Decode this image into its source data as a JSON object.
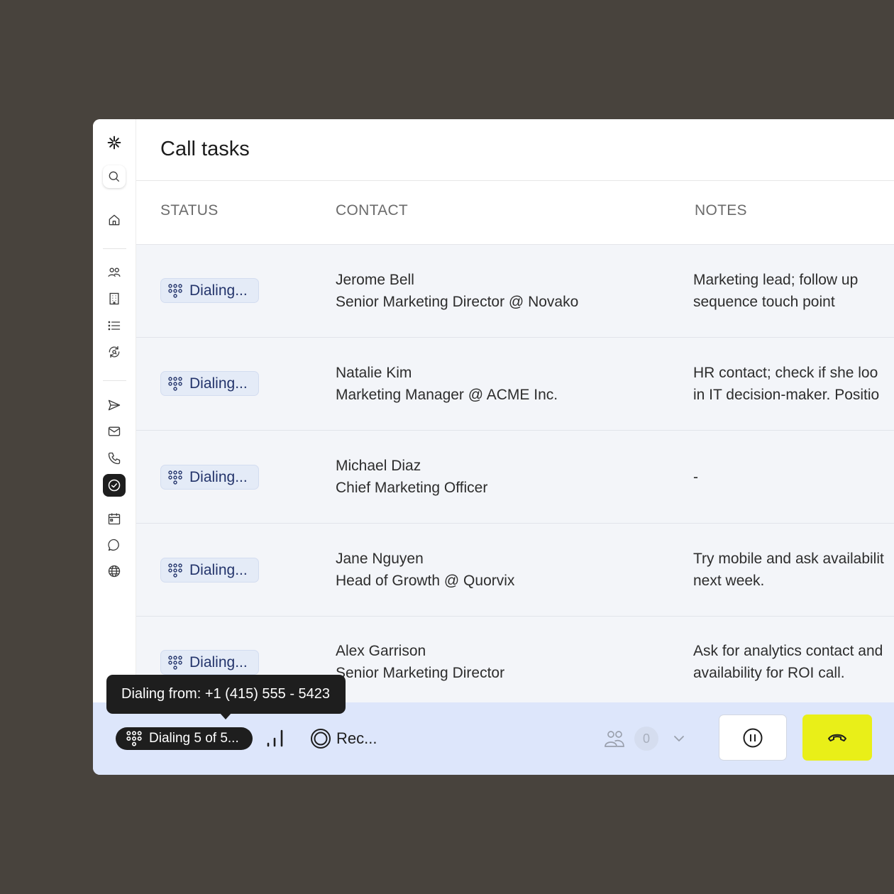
{
  "page": {
    "title": "Call tasks"
  },
  "sidebar": {
    "items": [
      {
        "icon": "logo-asterisk-icon"
      },
      {
        "icon": "search-icon"
      },
      {
        "icon": "home-icon"
      },
      {
        "icon": "people-icon"
      },
      {
        "icon": "building-icon"
      },
      {
        "icon": "list-icon"
      },
      {
        "icon": "sync-search-icon"
      },
      {
        "icon": "send-icon"
      },
      {
        "icon": "mail-icon"
      },
      {
        "icon": "phone-icon"
      },
      {
        "icon": "check-circle-icon",
        "active": true
      },
      {
        "icon": "calendar-icon"
      },
      {
        "icon": "chat-icon"
      },
      {
        "icon": "globe-icon"
      }
    ]
  },
  "table": {
    "columns": [
      "STATUS",
      "CONTACT",
      "NOTES"
    ],
    "rows": [
      {
        "status": "Dialing...",
        "name": "Jerome Bell",
        "title": "Senior Marketing Director @ Novako",
        "notes": [
          "Marketing lead; follow up",
          "sequence touch point"
        ]
      },
      {
        "status": "Dialing...",
        "name": "Natalie Kim",
        "title": "Marketing Manager @ ACME Inc.",
        "notes": [
          "HR contact; check if she loo",
          "in IT decision-maker.  Positio"
        ]
      },
      {
        "status": "Dialing...",
        "name": "Michael Diaz",
        "title": "Chief Marketing Officer",
        "notes": [
          "-",
          ""
        ]
      },
      {
        "status": "Dialing...",
        "name": "Jane Nguyen",
        "title": "Head of Growth @ Quorvix",
        "notes": [
          "Try mobile and ask availabilit",
          "next week."
        ]
      },
      {
        "status": "Dialing...",
        "name": "Alex Garrison",
        "title": "Senior Marketing Director",
        "notes": [
          "Ask for analytics contact and",
          "availability for ROI call."
        ]
      }
    ]
  },
  "bottombar": {
    "dialing_label": "Dialing 5 of 5...",
    "record_label": "Rec...",
    "participant_count": "0",
    "tooltip": "Dialing from: +1 (415) 555 - 5423",
    "hangup_color": "#e9ef18"
  }
}
